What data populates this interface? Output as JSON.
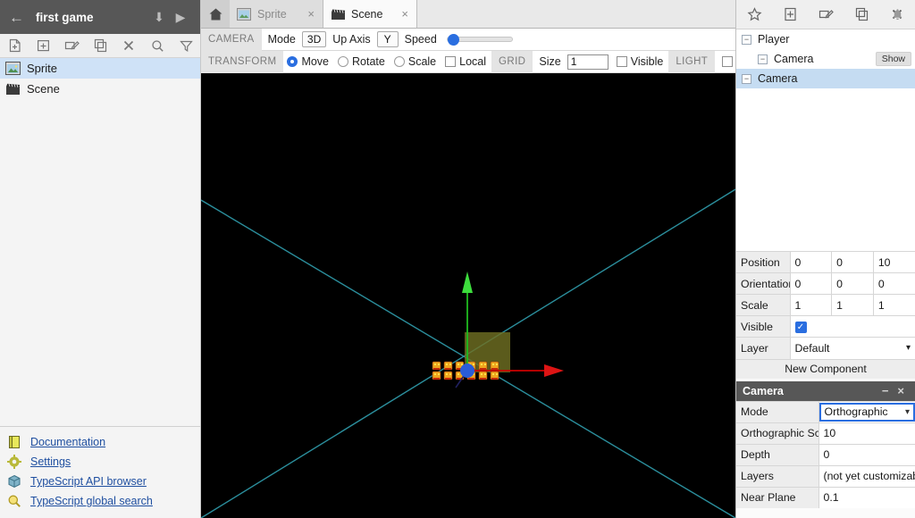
{
  "left": {
    "project_title": "first game",
    "back_icon": "back-arrow-icon",
    "download_icon": "download-icon",
    "play_icon": "play-icon",
    "toolbar": [
      {
        "name": "new-file-icon",
        "title": "New file"
      },
      {
        "name": "new-folder-icon",
        "title": "New folder"
      },
      {
        "name": "rename-icon",
        "title": "Rename"
      },
      {
        "name": "duplicate-icon",
        "title": "Duplicate"
      },
      {
        "name": "delete-icon",
        "title": "Delete"
      },
      {
        "name": "search-icon",
        "title": "Search"
      },
      {
        "name": "filter-icon",
        "title": "Filter"
      }
    ],
    "assets": [
      {
        "label": "Sprite",
        "icon": "image-asset-icon",
        "selected": true
      },
      {
        "label": "Scene",
        "icon": "clapperboard-asset-icon",
        "selected": false
      }
    ],
    "links": [
      {
        "label": "Documentation",
        "icon": "book-icon"
      },
      {
        "label": "Settings",
        "icon": "gear-icon"
      },
      {
        "label": "TypeScript API browser",
        "icon": "cube-icon"
      },
      {
        "label": "TypeScript global search",
        "icon": "magnifier-icon"
      }
    ]
  },
  "center": {
    "home_tab_icon": "home-icon",
    "tabs": [
      {
        "label": "Sprite",
        "icon": "image-tab-icon",
        "active": false,
        "close": "×"
      },
      {
        "label": "Scene",
        "icon": "clapperboard-tab-icon",
        "active": true,
        "close": "×"
      }
    ],
    "camera_row": {
      "group_label": "CAMERA",
      "mode_label": "Mode",
      "mode_value": "3D",
      "up_axis_label": "Up Axis",
      "up_axis_value": "Y",
      "speed_label": "Speed",
      "speed_percent": 8
    },
    "transform_row": {
      "group_label": "TRANSFORM",
      "options": [
        {
          "label": "Move",
          "checked": true
        },
        {
          "label": "Rotate",
          "checked": false
        },
        {
          "label": "Scale",
          "checked": false
        }
      ],
      "local_label": "Local",
      "local_checked": false,
      "grid_label": "GRID",
      "size_label": "Size",
      "size_value": "1",
      "grid_visible_label": "Visible",
      "grid_visible_checked": false,
      "light_label": "LIGHT",
      "light_checked": false
    },
    "viewport": {
      "background": "#000000",
      "grid_line_color": "#2f9aa8",
      "x_axis_color": "#cc0000",
      "y_axis_color": "#00b200",
      "origin_handle_color": "#2a5cd8",
      "camera_box_color": "#6b6b20"
    }
  },
  "right": {
    "toolbar": [
      {
        "name": "new-prefab-icon",
        "title": "New prefab"
      },
      {
        "name": "new-actor-icon",
        "title": "New actor"
      },
      {
        "name": "rename-actor-icon",
        "title": "Rename"
      },
      {
        "name": "duplicate-actor-icon",
        "title": "Duplicate"
      },
      {
        "name": "delete-actor-icon",
        "title": "Delete"
      }
    ],
    "hierarchy": [
      {
        "label": "Player",
        "depth": 0,
        "expander": "−",
        "selected": false,
        "action": ""
      },
      {
        "label": "Camera",
        "depth": 1,
        "expander": "−",
        "selected": false,
        "action": "Show"
      },
      {
        "label": "Camera",
        "depth": 0,
        "expander": "−",
        "selected": true,
        "action": ""
      }
    ],
    "transform": {
      "rows": [
        {
          "key": "Position",
          "values": [
            "0",
            "0",
            "10"
          ]
        },
        {
          "key": "Orientation",
          "values": [
            "0",
            "0",
            "0"
          ]
        },
        {
          "key": "Scale",
          "values": [
            "1",
            "1",
            "1"
          ]
        }
      ],
      "visible_label": "Visible",
      "visible_checked": true,
      "layer_label": "Layer",
      "layer_value": "Default",
      "new_component_label": "New Component"
    },
    "component": {
      "title": "Camera",
      "minimize": "−",
      "close": "×",
      "rows": [
        {
          "key": "Mode",
          "value": "Orthographic",
          "type": "select",
          "focused": true
        },
        {
          "key": "Orthographic Scale",
          "value": "10",
          "type": "text"
        },
        {
          "key": "Depth",
          "value": "0",
          "type": "text"
        },
        {
          "key": "Layers",
          "value": "(not yet customizable)",
          "type": "muted"
        },
        {
          "key": "Near Plane",
          "value": "0.1",
          "type": "text"
        }
      ]
    }
  },
  "notifications": {
    "bell_icon": "bell-icon"
  },
  "colors": {
    "accent": "#2a6ee0",
    "selection": "#c5dcf2",
    "dark_bar": "#575757",
    "link": "#1f4fa0"
  }
}
